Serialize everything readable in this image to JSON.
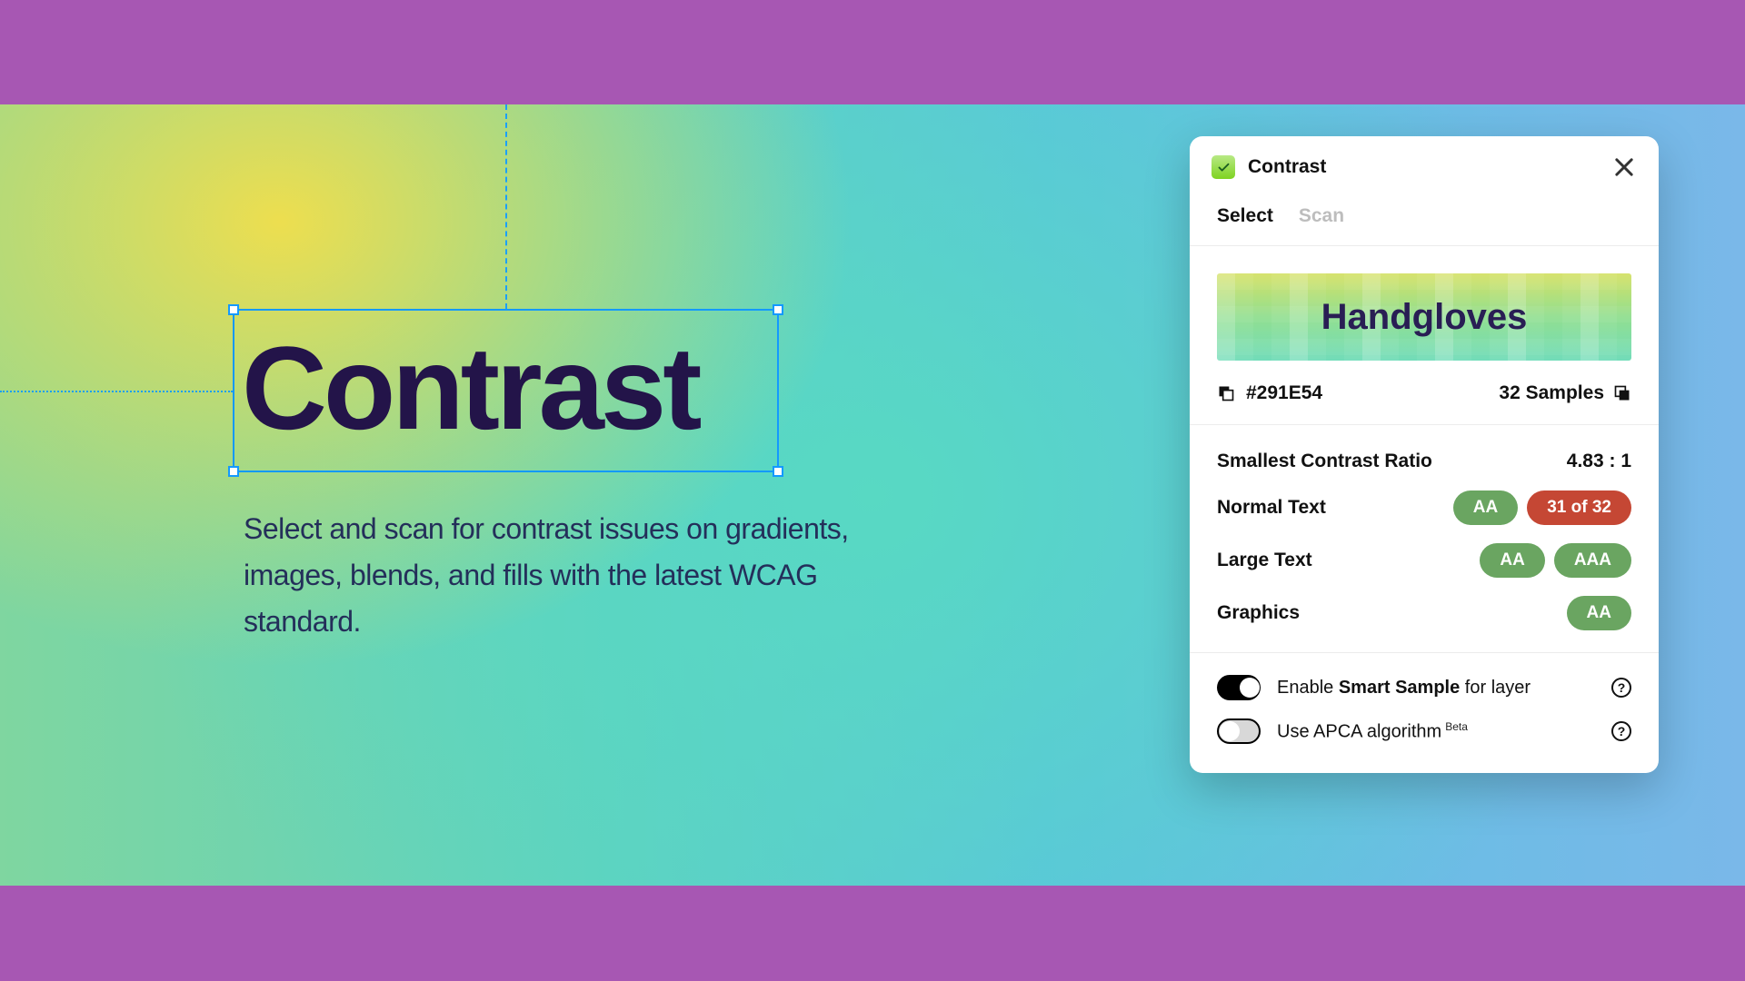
{
  "canvas": {
    "headline": "Contrast",
    "subtitle": "Select and scan for contrast issues on gradients, images, blends, and fills with the latest WCAG standard."
  },
  "panel": {
    "title": "Contrast",
    "tabs": {
      "select": "Select",
      "scan": "Scan"
    },
    "preview_text": "Handgloves",
    "hex": "#291E54",
    "samples": "32 Samples",
    "ratio_label": "Smallest Contrast Ratio",
    "ratio_value": "4.83 : 1",
    "rows": {
      "normal": {
        "label": "Normal Text",
        "pill1": "AA",
        "pill2": "31 of 32"
      },
      "large": {
        "label": "Large Text",
        "pill1": "AA",
        "pill2": "AAA"
      },
      "graphics": {
        "label": "Graphics",
        "pill1": "AA"
      }
    },
    "options": {
      "smart_prefix": "Enable ",
      "smart_bold": "Smart Sample",
      "smart_suffix": " for layer",
      "apca_text": "Use APCA algorithm",
      "apca_badge": "Beta",
      "help_glyph": "?"
    }
  }
}
